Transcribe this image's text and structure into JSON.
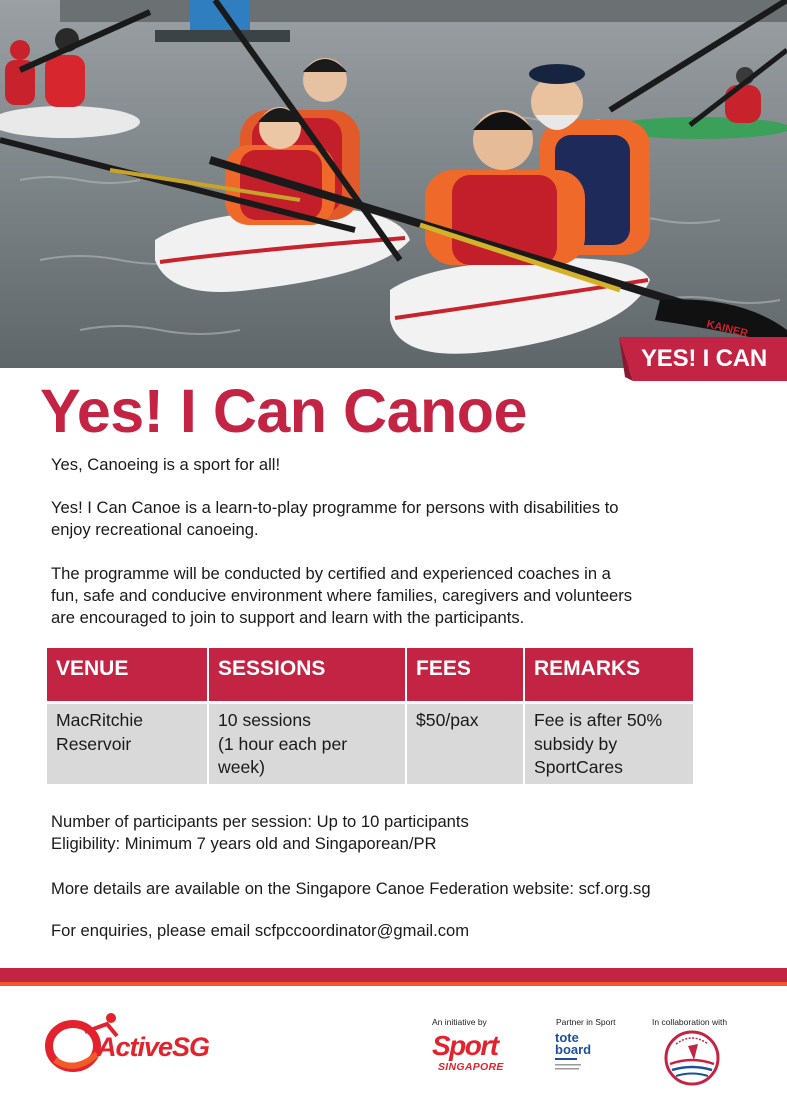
{
  "hero": {
    "badge_text": "YES! I CAN",
    "paddle_brand": "KAINER"
  },
  "title": "Yes! I Can Canoe",
  "intro": {
    "tagline": "Yes, Canoeing is a sport for all!",
    "description_lines": [
      "Yes! I Can Canoe is a learn-to-play programme for persons with disabilities to",
      "enjoy recreational canoeing."
    ],
    "programme_lines": [
      "The programme will be conducted by certified and experienced coaches in a",
      "fun, safe and conducive environment where families, caregivers and volunteers",
      "are encouraged to join to support and learn with the participants."
    ]
  },
  "table": {
    "headers": [
      "VENUE",
      "SESSIONS",
      "FEES",
      "REMARKS"
    ],
    "rows": [
      [
        [
          "MacRitchie",
          "Reservoir"
        ],
        [
          "10 sessions",
          "(1 hour each per",
          "week)"
        ],
        [
          "$50/pax"
        ],
        [
          "Fee is after 50%",
          "subsidy by",
          "SportCares"
        ]
      ]
    ]
  },
  "details": {
    "participants": "Number of participants per session: Up to 10 participants",
    "eligibility": "Eligibility: Minimum 7 years old and Singaporean/PR",
    "website": "More details are available on the Singapore Canoe Federation website: scf.org.sg",
    "enquiries": "For enquiries, please email scfpccoordinator@gmail.com"
  },
  "footer": {
    "activesg_logo_text": "ActiveSG",
    "initiative_label": "An initiative by",
    "sport_logo_word": "Sport",
    "sport_logo_sub": "SINGAPORE",
    "partner_label": "Partner in Sport",
    "tote_logo_word_1": "tote",
    "tote_logo_word_2": "board",
    "collab_label": "In collaboration with",
    "scf_logo_text": "SINGAPORE CANOE FEDERATION"
  },
  "colors": {
    "brand_red": "#c42443",
    "accent_orange": "#f15a29",
    "table_cell_gray": "#d9d9d9",
    "logo_red": "#e2232e",
    "tote_blue": "#1c4f9c"
  }
}
